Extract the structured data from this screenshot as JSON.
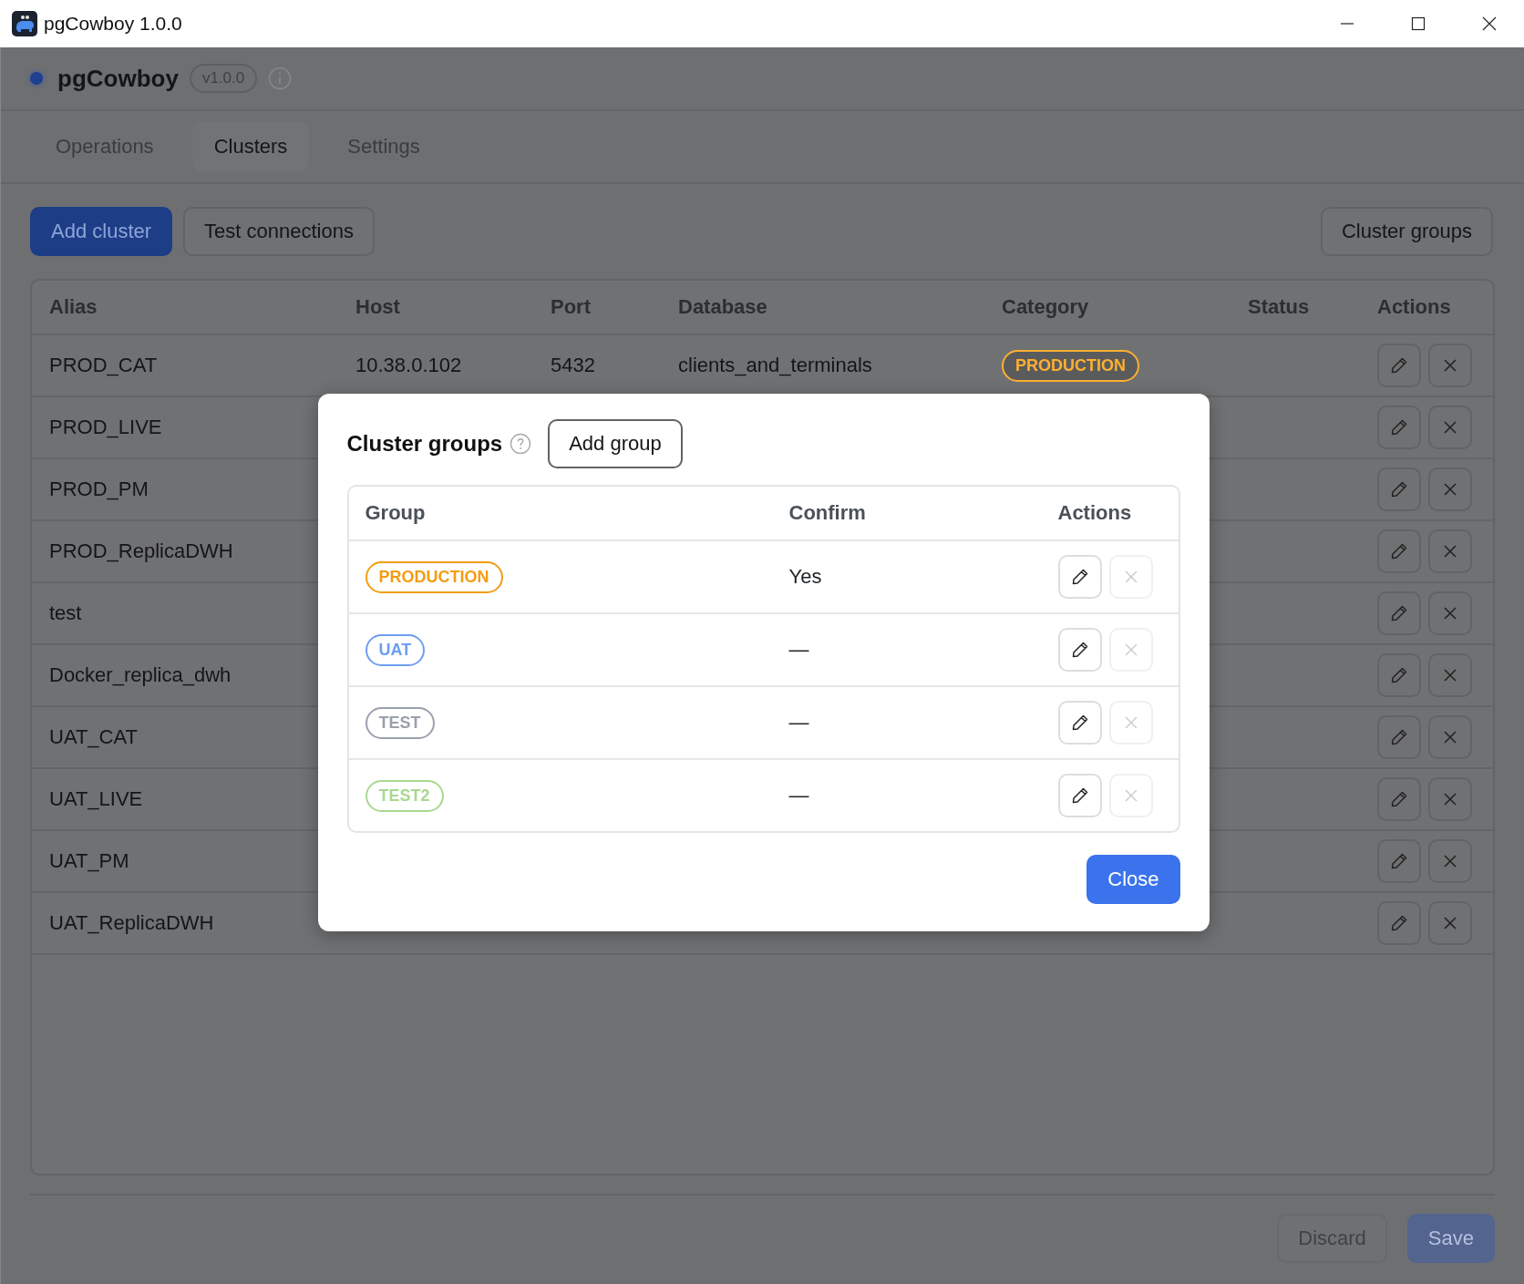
{
  "window": {
    "title": "pgCowboy 1.0.0"
  },
  "header": {
    "app_name": "pgCowboy",
    "version": "v1.0.0"
  },
  "tabs": [
    {
      "label": "Operations",
      "selected": false
    },
    {
      "label": "Clusters",
      "selected": true
    },
    {
      "label": "Settings",
      "selected": false
    }
  ],
  "toolbar": {
    "add_button": "Add cluster",
    "test_button": "Test connections",
    "groups_button": "Cluster groups"
  },
  "table": {
    "columns": [
      "Alias",
      "Host",
      "Port",
      "Database",
      "Category",
      "Status",
      "Actions"
    ],
    "rows": [
      {
        "alias": "PROD_CAT",
        "host": "10.38.0.102",
        "port": "5432",
        "database": "clients_and_terminals",
        "category": {
          "label": "PRODUCTION",
          "color": "#ffb030"
        }
      },
      {
        "alias": "PROD_LIVE"
      },
      {
        "alias": "PROD_PM"
      },
      {
        "alias": "PROD_ReplicaDWH"
      },
      {
        "alias": "test"
      },
      {
        "alias": "Docker_replica_dwh"
      },
      {
        "alias": "UAT_CAT"
      },
      {
        "alias": "UAT_LIVE"
      },
      {
        "alias": "UAT_PM"
      },
      {
        "alias": "UAT_ReplicaDWH"
      }
    ]
  },
  "footer": {
    "buttons": [
      {
        "label": "Discard",
        "kind": "secondary",
        "disabled": true
      },
      {
        "label": "Save",
        "kind": "primary",
        "disabled": true
      }
    ]
  },
  "modal": {
    "title": "Cluster groups",
    "add_button": "Add group",
    "columns": [
      "Group",
      "Confirm",
      "Actions"
    ],
    "rows": [
      {
        "label": "PRODUCTION",
        "color": "#f39c12",
        "confirm": "Yes",
        "delete_disabled": true
      },
      {
        "label": "UAT",
        "color": "#6d9ef0",
        "confirm": "—",
        "delete_disabled": true
      },
      {
        "label": "TEST",
        "color": "#9aa0ac",
        "confirm": "—",
        "delete_disabled": true
      },
      {
        "label": "TEST2",
        "color": "#a8d890",
        "confirm": "—",
        "delete_disabled": true
      }
    ],
    "close_button": "Close"
  }
}
